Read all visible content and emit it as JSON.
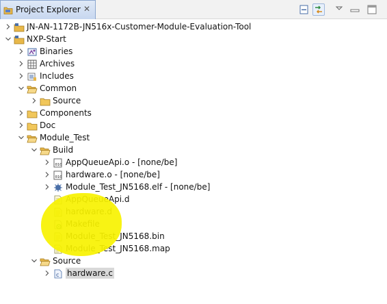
{
  "view": {
    "tab_title": "Project Explorer",
    "close_glyph": "✕"
  },
  "toolbar": {
    "collapse_all_icon": "collapse-all-icon",
    "link_editor_icon": "link-with-editor-icon",
    "view_menu_icon": "view-menu-icon",
    "minimize_icon": "minimize-icon",
    "maximize_icon": "maximize-icon"
  },
  "tree": {
    "items": [
      {
        "label": "JN-AN-1172B-JN516x-Customer-Module-Evaluation-Tool",
        "depth": 0,
        "twisty": "collapsed",
        "icon": "project-folder-icon"
      },
      {
        "label": "NXP-Start",
        "depth": 0,
        "twisty": "expanded",
        "icon": "project-folder-icon"
      },
      {
        "label": "Binaries",
        "depth": 1,
        "twisty": "collapsed",
        "icon": "binaries-icon"
      },
      {
        "label": "Archives",
        "depth": 1,
        "twisty": "collapsed",
        "icon": "archives-icon"
      },
      {
        "label": "Includes",
        "depth": 1,
        "twisty": "collapsed",
        "icon": "includes-icon"
      },
      {
        "label": "Common",
        "depth": 1,
        "twisty": "expanded",
        "icon": "folder-open-icon"
      },
      {
        "label": "Source",
        "depth": 2,
        "twisty": "collapsed",
        "icon": "folder-icon"
      },
      {
        "label": "Components",
        "depth": 1,
        "twisty": "collapsed",
        "icon": "folder-icon"
      },
      {
        "label": "Doc",
        "depth": 1,
        "twisty": "collapsed",
        "icon": "folder-icon"
      },
      {
        "label": "Module_Test",
        "depth": 1,
        "twisty": "expanded",
        "icon": "folder-open-icon"
      },
      {
        "label": "Build",
        "depth": 2,
        "twisty": "expanded",
        "icon": "folder-open-icon"
      },
      {
        "label": "AppQueueApi.o - [none/be]",
        "depth": 3,
        "twisty": "collapsed",
        "icon": "object-file-icon"
      },
      {
        "label": "hardware.o - [none/be]",
        "depth": 3,
        "twisty": "collapsed",
        "icon": "object-file-icon"
      },
      {
        "label": "Module_Test_JN5168.elf - [none/be]",
        "depth": 3,
        "twisty": "collapsed",
        "icon": "executable-icon"
      },
      {
        "label": "AppQueueApi.d",
        "depth": 3,
        "twisty": "none",
        "icon": "text-file-icon"
      },
      {
        "label": "hardware.d",
        "depth": 3,
        "twisty": "none",
        "icon": "text-file-icon"
      },
      {
        "label": "Makefile",
        "depth": 3,
        "twisty": "none",
        "icon": "makefile-icon"
      },
      {
        "label": "Module_Test_JN5168.bin",
        "depth": 3,
        "twisty": "none",
        "icon": "text-file-icon"
      },
      {
        "label": "Module_Test_JN5168.map",
        "depth": 3,
        "twisty": "none",
        "icon": "text-file-icon"
      },
      {
        "label": "Source",
        "depth": 2,
        "twisty": "expanded",
        "icon": "folder-open-icon"
      },
      {
        "label": "hardware.c",
        "depth": 3,
        "twisty": "collapsed",
        "icon": "c-source-icon",
        "selected": true
      }
    ]
  },
  "annotation": {
    "highlight_color": "#f7f200"
  },
  "colors": {
    "tab_border": "#8aa6cf",
    "folder": "#e8b84a",
    "selection": "#d9d9d9"
  }
}
